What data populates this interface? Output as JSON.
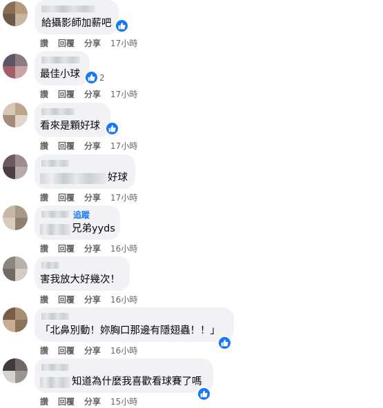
{
  "actions": {
    "like": "讚",
    "reply": "回覆",
    "share": "分享"
  },
  "comments": [
    {
      "text": "給攝影師加薪吧",
      "time": "17小時",
      "likes": ""
    },
    {
      "text": "最佳小球",
      "time": "17小時",
      "likes": "2"
    },
    {
      "text": "看來是顆好球",
      "time": "17小時",
      "likes": ""
    },
    {
      "text": "好球",
      "time": "17小時",
      "likes": ""
    },
    {
      "text": "兄弟yyds",
      "time": "16小時",
      "likes": "",
      "follow": "追蹤"
    },
    {
      "text": "害我放大好幾次！",
      "time": "16小時",
      "likes": ""
    },
    {
      "text": "「北鼻別動！妳胸口那邊有隱翅蟲！！」",
      "time": "16小時",
      "likes": ""
    },
    {
      "text": "知道為什麼我喜歡看球賽了嗎",
      "time": "15小時",
      "likes": ""
    }
  ],
  "colors": {
    "accent": "#1877f2",
    "bubble": "#f0f2f5",
    "meta": "#65676b"
  },
  "icons": {
    "reaction": "like-thumb-icon"
  }
}
